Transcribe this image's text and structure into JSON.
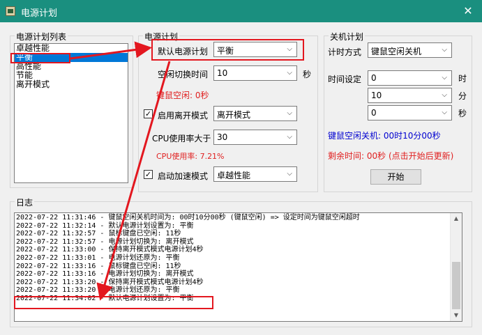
{
  "window": {
    "title": "电源计划",
    "close_glyph": "✕"
  },
  "plan_list": {
    "title": "电源计划列表",
    "items": [
      {
        "label": "卓越性能"
      },
      {
        "label": "平衡",
        "selected": true
      },
      {
        "label": "高性能"
      },
      {
        "label": "节能"
      },
      {
        "label": "离开模式"
      }
    ]
  },
  "power_plan": {
    "title": "电源计划",
    "default_plan_label": "默认电源计划",
    "default_plan_value": "平衡",
    "idle_switch_label": "空闲切换时间",
    "idle_switch_value": "10",
    "idle_switch_unit": "秒",
    "idle_status": "键鼠空闲: 0秒",
    "enable_away_label": "启用离开模式",
    "enable_away_checked": true,
    "away_mode_value": "离开模式",
    "cpu_threshold_label": "CPU使用率大于",
    "cpu_threshold_value": "30",
    "cpu_usage_status": "CPU使用率: 7.21%",
    "boost_label": "启动加速模式",
    "boost_checked": true,
    "boost_value": "卓越性能"
  },
  "shutdown_plan": {
    "title": "关机计划",
    "timing_label": "计时方式",
    "timing_value": "键鼠空闲关机",
    "time_label": "时间设定",
    "hour_value": "0",
    "hour_unit": "时",
    "minute_value": "10",
    "minute_unit": "分",
    "second_value": "0",
    "second_unit": "秒",
    "status_text": "键鼠空闲关机: 00时10分00秒",
    "remaining_text": "剩余时间: 00秒 (点击开始后更新)",
    "start_button": "开始"
  },
  "log": {
    "title": "日志",
    "lines": [
      "2022-07-22 11:31:46 - 键鼠空闲关机时间为: 00时10分00秒 (键鼠空闲) => 设定时间为键鼠空闲超时",
      "2022-07-22 11:32:14 - 默认电源计划设置为: 平衡",
      "2022-07-22 11:32:57 - 鼠标键盘已空闲: 11秒",
      "2022-07-22 11:32:57 - 电源计划切换为: 离开模式",
      "2022-07-22 11:33:00 - 保持离开模式模式电源计划4秒",
      "2022-07-22 11:33:01 - 电源计划还原为: 平衡",
      "2022-07-22 11:33:16 - 鼠标键盘已空闲: 11秒",
      "2022-07-22 11:33:16 - 电源计划切换为: 离开模式",
      "2022-07-22 11:33:20 - 保持离开模式模式电源计划4秒",
      "2022-07-22 11:33:20 - 电源计划还原为: 平衡",
      "2022-07-22 11:34:02 - 默认电源计划设置为: 平衡"
    ]
  },
  "icons": {
    "dropdown": "chevron-down-icon",
    "scroll_up": "scroll-up-arrow-icon",
    "scroll_down": "scroll-down-arrow-icon",
    "check": "checkmark-icon"
  },
  "colors": {
    "titlebar": "#1a8f7f",
    "selection": "#0078d7",
    "annotation": "#e3171f",
    "status_red": "#e02020",
    "status_blue": "#0000d0"
  }
}
